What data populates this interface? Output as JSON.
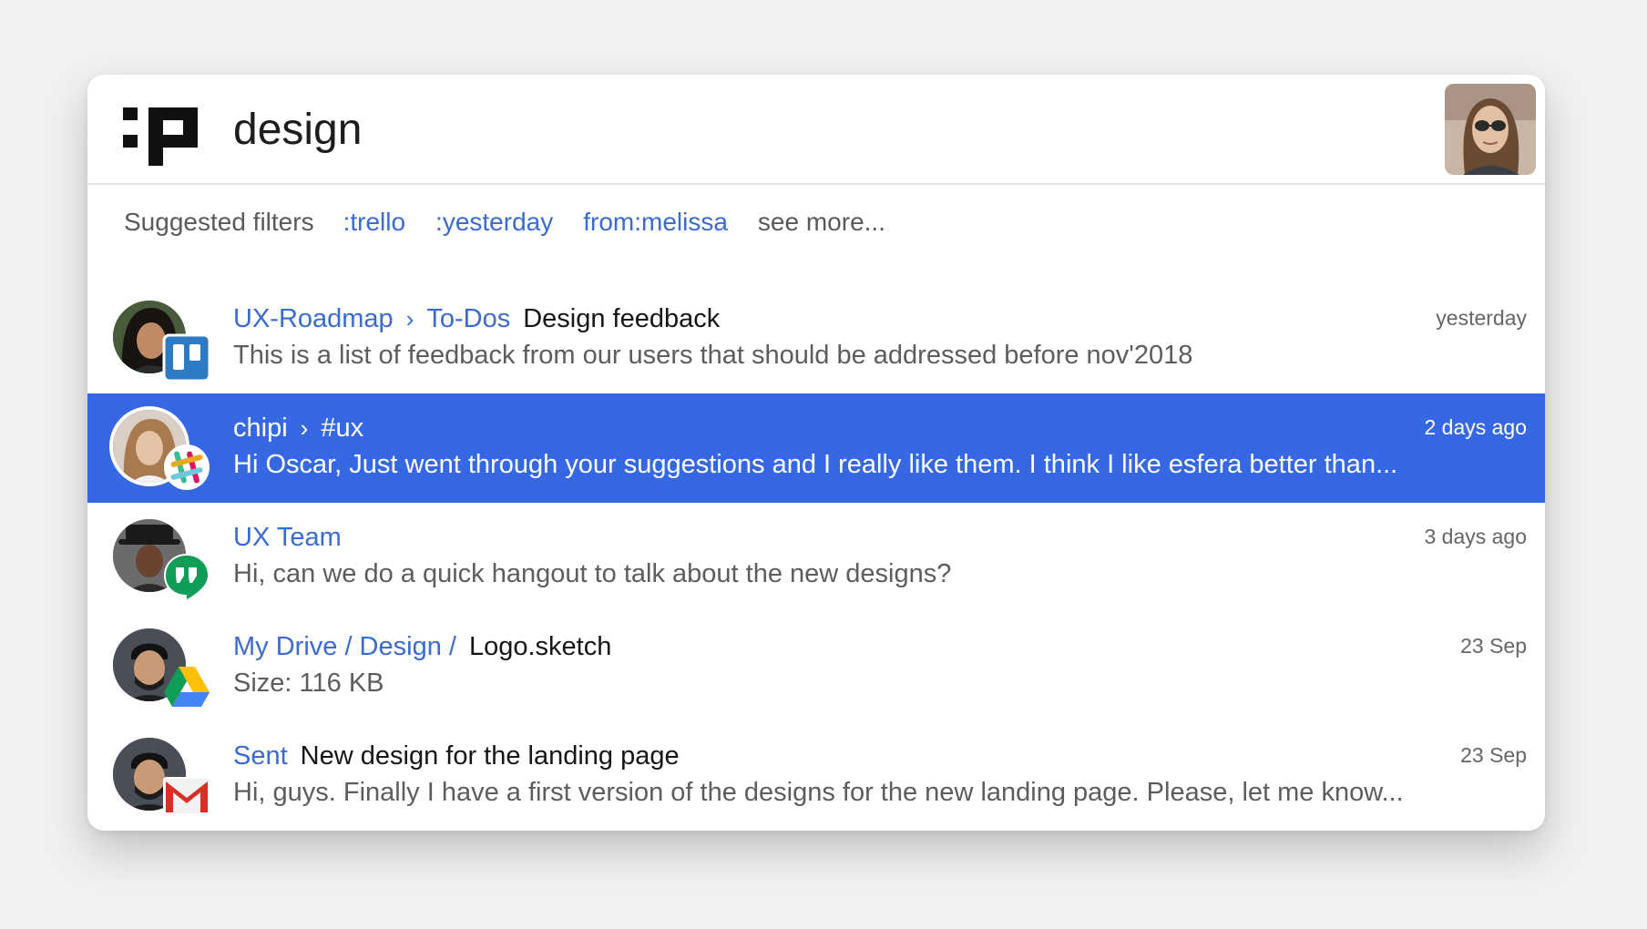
{
  "search": {
    "query": "design"
  },
  "filters": {
    "label": "Suggested filters",
    "items": [
      ":trello",
      ":yesterday",
      "from:melissa"
    ],
    "more": "see more..."
  },
  "results": [
    {
      "app": "trello",
      "crumbs": [
        "UX-Roadmap",
        "To-Dos"
      ],
      "separator": "›",
      "title": "Design feedback",
      "snippet": "This is a list of feedback from our users that should be addressed before nov'2018",
      "time": "yesterday"
    },
    {
      "app": "slack",
      "crumbs": [
        "chipi",
        "#ux"
      ],
      "separator": "›",
      "title": "",
      "snippet": "Hi Oscar, Just went through your suggestions and I really like them. I think I like esfera better than...",
      "time": "2 days ago",
      "selected": true
    },
    {
      "app": "hangouts",
      "crumbs": [
        "UX Team"
      ],
      "title": "",
      "snippet": "Hi, can we do a quick hangout to talk about the new designs?",
      "time": "3 days ago"
    },
    {
      "app": "google-drive",
      "crumbs": [
        "My Drive / Design /"
      ],
      "title": "Logo.sketch",
      "snippet": "Size: 116 KB",
      "time": "23 Sep"
    },
    {
      "app": "gmail",
      "crumbs": [
        "Sent"
      ],
      "title": "New design for the landing page",
      "snippet": "Hi, guys. Finally I have a first version of the designs for the new landing page. Please, let me know...",
      "time": "23 Sep"
    }
  ],
  "colors": {
    "accent": "#3668e4",
    "link": "#3b6bd1",
    "background": "#f1f1f1"
  }
}
